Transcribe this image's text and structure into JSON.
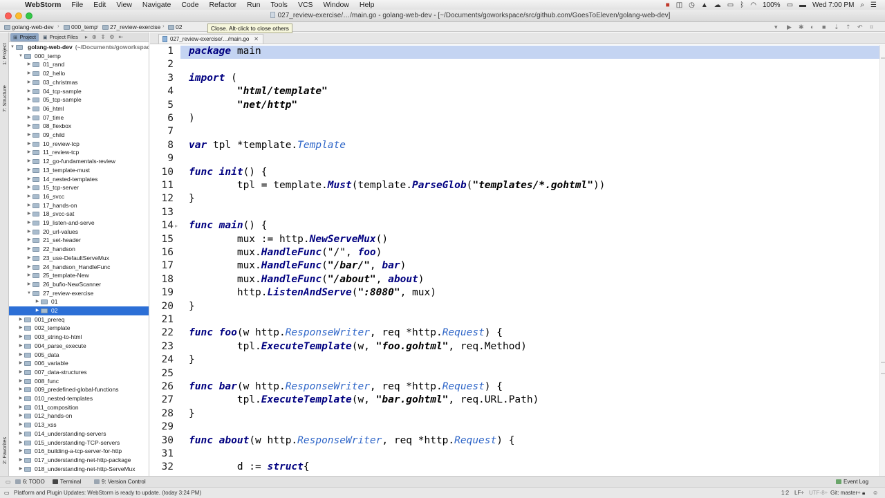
{
  "menubar": {
    "apple": "",
    "items": [
      "WebStorm",
      "File",
      "Edit",
      "View",
      "Navigate",
      "Code",
      "Refactor",
      "Run",
      "Tools",
      "VCS",
      "Window",
      "Help"
    ],
    "battery": "100%",
    "clock": "Wed 7:00 PM"
  },
  "window": {
    "title": "027_review-exercise/…/main.go - golang-web-dev - [~/Documents/goworkspace/src/github.com/GoesToEleven/golang-web-dev]"
  },
  "navbar": {
    "crumbs": [
      "golang-web-dev",
      "000_temp",
      "27_review-exercise",
      "02"
    ],
    "tooltip": "Close. Alt-click to close others"
  },
  "side_tabs": {
    "project": "1: Project",
    "structure": "7: Structure",
    "favorites": "2: Favorites"
  },
  "project_panel": {
    "tabs": [
      "Project",
      "Project Files"
    ],
    "root_name": "golang-web-dev",
    "root_path": "(~/Documents/goworkspace/src/github.com/GoesToEleven/golang-web-dev)",
    "items": [
      {
        "label": "000_temp",
        "depth": 1,
        "expanded": true
      },
      {
        "label": "01_rand",
        "depth": 2
      },
      {
        "label": "02_hello",
        "depth": 2
      },
      {
        "label": "03_christmas",
        "depth": 2
      },
      {
        "label": "04_tcp-sample",
        "depth": 2
      },
      {
        "label": "05_tcp-sample",
        "depth": 2
      },
      {
        "label": "06_html",
        "depth": 2
      },
      {
        "label": "07_time",
        "depth": 2
      },
      {
        "label": "08_flexbox",
        "depth": 2
      },
      {
        "label": "09_child",
        "depth": 2
      },
      {
        "label": "10_review-tcp",
        "depth": 2
      },
      {
        "label": "11_review-tcp",
        "depth": 2
      },
      {
        "label": "12_go-fundamentals-review",
        "depth": 2
      },
      {
        "label": "13_template-must",
        "depth": 2
      },
      {
        "label": "14_nested-templates",
        "depth": 2
      },
      {
        "label": "15_tcp-server",
        "depth": 2
      },
      {
        "label": "16_svcc",
        "depth": 2
      },
      {
        "label": "17_hands-on",
        "depth": 2
      },
      {
        "label": "18_svcc-sat",
        "depth": 2
      },
      {
        "label": "19_listen-and-serve",
        "depth": 2
      },
      {
        "label": "20_url-values",
        "depth": 2
      },
      {
        "label": "21_set-header",
        "depth": 2
      },
      {
        "label": "22_handson",
        "depth": 2
      },
      {
        "label": "23_use-DefaultServeMux",
        "depth": 2
      },
      {
        "label": "24_handson_HandleFunc",
        "depth": 2
      },
      {
        "label": "25_template-New",
        "depth": 2
      },
      {
        "label": "26_bufio-NewScanner",
        "depth": 2
      },
      {
        "label": "27_review-exercise",
        "depth": 2,
        "expanded": true
      },
      {
        "label": "01",
        "depth": 3
      },
      {
        "label": "02",
        "depth": 3,
        "selected": true
      },
      {
        "label": "001_prereq",
        "depth": 1
      },
      {
        "label": "002_template",
        "depth": 1
      },
      {
        "label": "003_string-to-html",
        "depth": 1
      },
      {
        "label": "004_parse_execute",
        "depth": 1
      },
      {
        "label": "005_data",
        "depth": 1
      },
      {
        "label": "006_variable",
        "depth": 1
      },
      {
        "label": "007_data-structures",
        "depth": 1
      },
      {
        "label": "008_func",
        "depth": 1
      },
      {
        "label": "009_predefined-global-functions",
        "depth": 1
      },
      {
        "label": "010_nested-templates",
        "depth": 1
      },
      {
        "label": "011_composition",
        "depth": 1
      },
      {
        "label": "012_hands-on",
        "depth": 1
      },
      {
        "label": "013_xss",
        "depth": 1
      },
      {
        "label": "014_understanding-servers",
        "depth": 1
      },
      {
        "label": "015_understanding-TCP-servers",
        "depth": 1
      },
      {
        "label": "016_building-a-tcp-server-for-http",
        "depth": 1
      },
      {
        "label": "017_understanding-net-http-package",
        "depth": 1
      },
      {
        "label": "018_understanding-net-http-ServeMux",
        "depth": 1
      }
    ]
  },
  "editor": {
    "tab_label": "027_review-exercise/…/main.go",
    "current_line": 1,
    "lines": [
      [
        [
          "kw",
          "package"
        ],
        [
          "p",
          " main"
        ]
      ],
      [],
      [
        [
          "kw",
          "import"
        ],
        [
          "p",
          " ("
        ]
      ],
      [
        [
          "p",
          "        "
        ],
        [
          "s",
          "\"html/template\""
        ]
      ],
      [
        [
          "p",
          "        "
        ],
        [
          "s",
          "\"net/http\""
        ]
      ],
      [
        [
          "p",
          ")"
        ]
      ],
      [],
      [
        [
          "kw",
          "var"
        ],
        [
          "p",
          " tpl *template."
        ],
        [
          "t",
          "Template"
        ]
      ],
      [],
      [
        [
          "kw",
          "func"
        ],
        [
          "p",
          " "
        ],
        [
          "f",
          "init"
        ],
        [
          "p",
          "() {"
        ]
      ],
      [
        [
          "p",
          "        tpl = template."
        ],
        [
          "f",
          "Must"
        ],
        [
          "p",
          "(template."
        ],
        [
          "f",
          "ParseGlob"
        ],
        [
          "p",
          "("
        ],
        [
          "s",
          "\"templates/*.gohtml\""
        ],
        [
          "p",
          "))"
        ]
      ],
      [
        [
          "p",
          "}"
        ]
      ],
      [],
      [
        [
          "kw",
          "func"
        ],
        [
          "p",
          " "
        ],
        [
          "f",
          "main"
        ],
        [
          "p",
          "() {"
        ]
      ],
      [
        [
          "p",
          "        mux := http."
        ],
        [
          "f",
          "NewServeMux"
        ],
        [
          "p",
          "()"
        ]
      ],
      [
        [
          "p",
          "        mux."
        ],
        [
          "f",
          "HandleFunc"
        ],
        [
          "p",
          "(\"/\", "
        ],
        [
          "f",
          "foo"
        ],
        [
          "p",
          ")"
        ]
      ],
      [
        [
          "p",
          "        mux."
        ],
        [
          "f",
          "HandleFunc"
        ],
        [
          "p",
          "("
        ],
        [
          "s",
          "\"/bar/\""
        ],
        [
          "p",
          ", "
        ],
        [
          "f",
          "bar"
        ],
        [
          "p",
          ")"
        ]
      ],
      [
        [
          "p",
          "        mux."
        ],
        [
          "f",
          "HandleFunc"
        ],
        [
          "p",
          "("
        ],
        [
          "s",
          "\"/about\""
        ],
        [
          "p",
          ", "
        ],
        [
          "f",
          "about"
        ],
        [
          "p",
          ")"
        ]
      ],
      [
        [
          "p",
          "        http."
        ],
        [
          "f",
          "ListenAndServe"
        ],
        [
          "p",
          "("
        ],
        [
          "s",
          "\":8080\""
        ],
        [
          "p",
          ", mux)"
        ]
      ],
      [
        [
          "p",
          "}"
        ]
      ],
      [],
      [
        [
          "kw",
          "func"
        ],
        [
          "p",
          " "
        ],
        [
          "f",
          "foo"
        ],
        [
          "p",
          "(w http."
        ],
        [
          "t",
          "ResponseWriter"
        ],
        [
          "p",
          ", req *http."
        ],
        [
          "t",
          "Request"
        ],
        [
          "p",
          ") {"
        ]
      ],
      [
        [
          "p",
          "        tpl."
        ],
        [
          "f",
          "ExecuteTemplate"
        ],
        [
          "p",
          "(w, "
        ],
        [
          "s",
          "\"foo.gohtml\""
        ],
        [
          "p",
          ", req.Method)"
        ]
      ],
      [
        [
          "p",
          "}"
        ]
      ],
      [],
      [
        [
          "kw",
          "func"
        ],
        [
          "p",
          " "
        ],
        [
          "f",
          "bar"
        ],
        [
          "p",
          "(w http."
        ],
        [
          "t",
          "ResponseWriter"
        ],
        [
          "p",
          ", req *http."
        ],
        [
          "t",
          "Request"
        ],
        [
          "p",
          ") {"
        ]
      ],
      [
        [
          "p",
          "        tpl."
        ],
        [
          "f",
          "ExecuteTemplate"
        ],
        [
          "p",
          "(w, "
        ],
        [
          "s",
          "\"bar.gohtml\""
        ],
        [
          "p",
          ", req.URL.Path)"
        ]
      ],
      [
        [
          "p",
          "}"
        ]
      ],
      [],
      [
        [
          "kw",
          "func"
        ],
        [
          "p",
          " "
        ],
        [
          "f",
          "about"
        ],
        [
          "p",
          "(w http."
        ],
        [
          "t",
          "ResponseWriter"
        ],
        [
          "p",
          ", req *http."
        ],
        [
          "t",
          "Request"
        ],
        [
          "p",
          ") {"
        ]
      ],
      [],
      [
        [
          "p",
          "        d := "
        ],
        [
          "kw",
          "struct"
        ],
        [
          "p",
          "{"
        ]
      ]
    ]
  },
  "bottom_tools": {
    "todo": "6: TODO",
    "terminal": "Terminal",
    "version_control": "9: Version Control",
    "event_log": "Event Log"
  },
  "status": {
    "message": "Platform and Plugin Updates: WebStorm is ready to update. (today 3:24 PM)",
    "position": "1:2",
    "line_sep": "LF÷",
    "encoding": "UTF-8÷",
    "git": "Git: master÷"
  },
  "colors": {
    "selection": "#2c6fd6",
    "current_line": "#c4d4f2",
    "keyword": "#000080",
    "type": "#2f66c8"
  }
}
